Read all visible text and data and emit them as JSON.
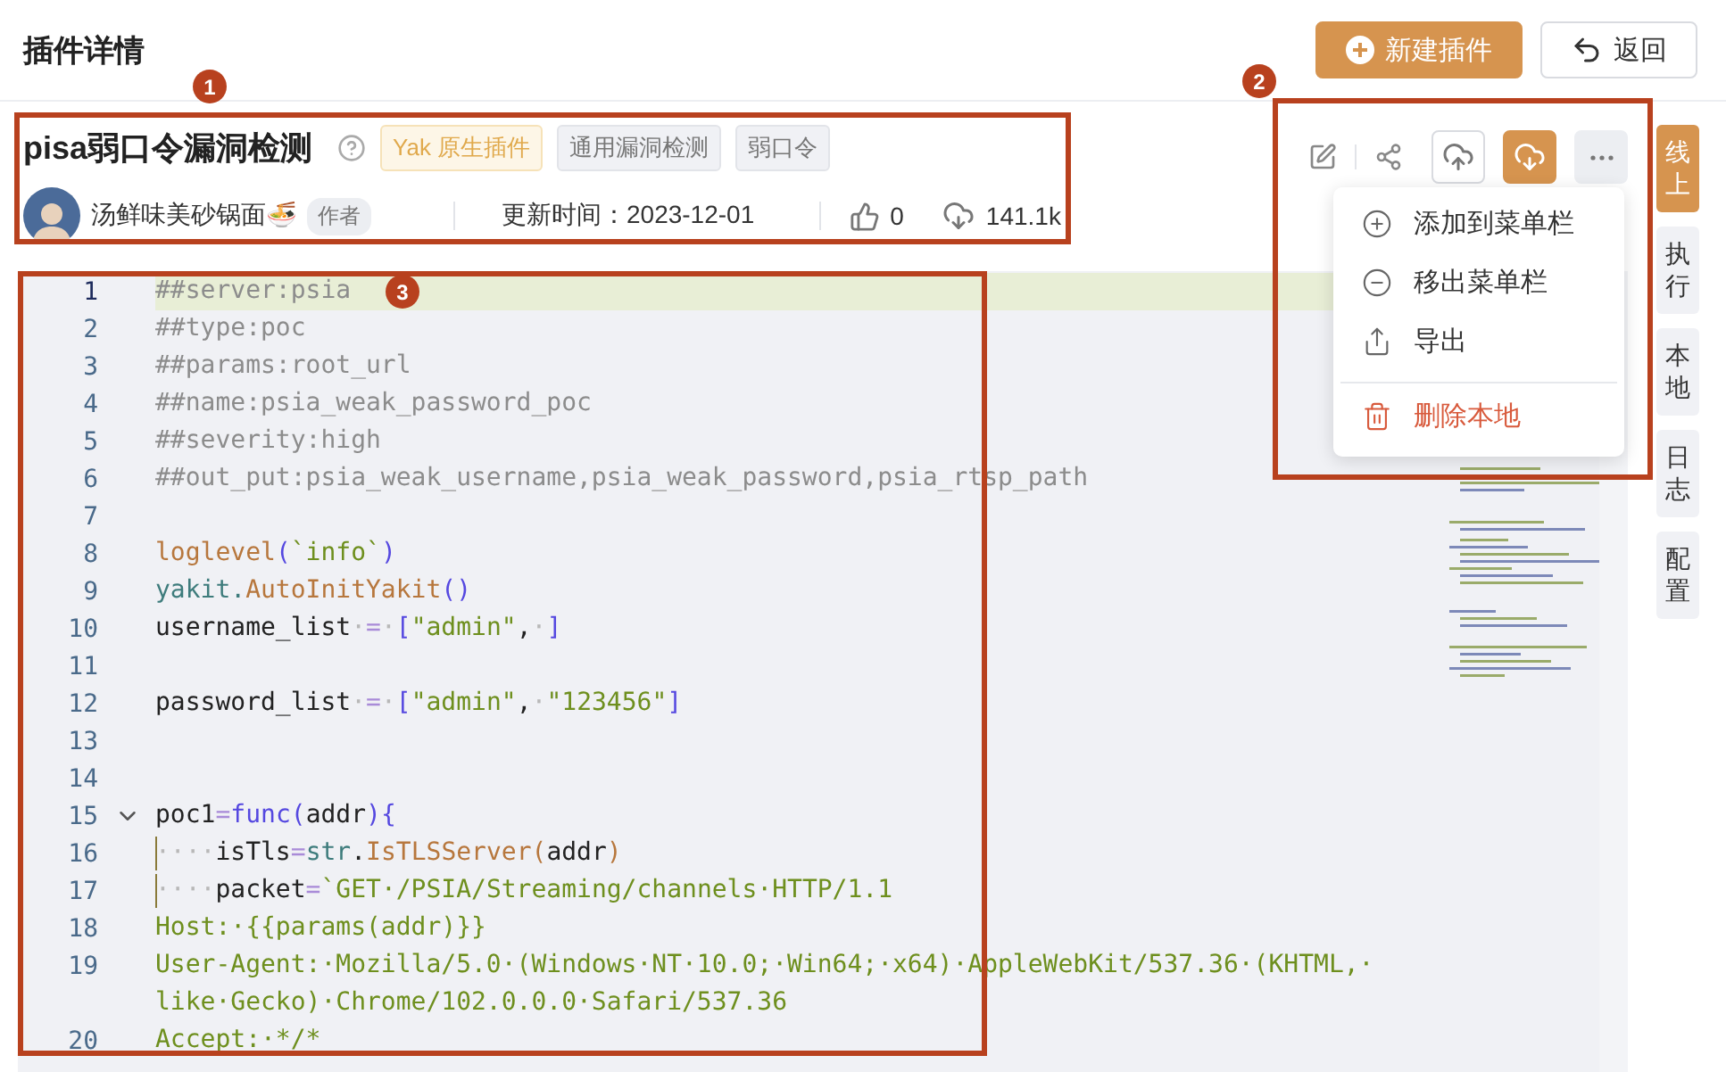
{
  "header": {
    "title": "插件详情",
    "new_button": "新建插件",
    "back_button": "返回"
  },
  "plugin": {
    "name": "pisa弱口令漏洞检测",
    "tags": [
      {
        "label": "Yak 原生插件",
        "kind": "type"
      },
      {
        "label": "通用漏洞检测",
        "kind": "tag"
      },
      {
        "label": "弱口令",
        "kind": "tag"
      }
    ],
    "author": "汤鲜味美砂锅面🍜",
    "author_badge": "作者",
    "updated": "更新时间：2023-12-01",
    "likes": "0",
    "downloads": "141.1k"
  },
  "menu": [
    {
      "label": "添加到菜单栏",
      "kind": "add",
      "danger": false
    },
    {
      "label": "移出菜单栏",
      "kind": "remove",
      "danger": false
    },
    {
      "label": "导出",
      "kind": "export",
      "danger": false
    },
    {
      "label": "删除本地",
      "kind": "delete",
      "danger": true
    }
  ],
  "tabs": [
    {
      "label": "线上",
      "selected": true
    },
    {
      "label": "执行",
      "selected": false
    },
    {
      "label": "本地",
      "selected": false
    },
    {
      "label": "日志",
      "selected": false
    },
    {
      "label": "配置",
      "selected": false
    }
  ],
  "code": {
    "lines": [
      {
        "number": "1",
        "current": true,
        "segments": [
          {
            "kind": "comment",
            "text": "##server:psia"
          }
        ]
      },
      {
        "number": "2",
        "segments": [
          {
            "kind": "comment",
            "text": "##type:poc"
          }
        ]
      },
      {
        "number": "3",
        "segments": [
          {
            "kind": "comment",
            "text": "##params:root_url"
          }
        ]
      },
      {
        "number": "4",
        "segments": [
          {
            "kind": "comment",
            "text": "##name:psia_weak_password_poc"
          }
        ]
      },
      {
        "number": "5",
        "segments": [
          {
            "kind": "comment",
            "text": "##severity:high"
          }
        ]
      },
      {
        "number": "6",
        "segments": [
          {
            "kind": "comment",
            "text": "##out_put:psia_weak_username,psia_weak_password,psia_rtsp_path"
          }
        ]
      },
      {
        "number": "7"
      },
      {
        "number": "8",
        "segments": [
          {
            "kind": "func",
            "text": "loglevel"
          },
          {
            "kind": "keyword",
            "text": "("
          },
          {
            "kind": "string",
            "text": "`info`"
          },
          {
            "kind": "keyword",
            "text": ")"
          }
        ]
      },
      {
        "number": "9",
        "segments": [
          {
            "kind": "object",
            "text": "yakit."
          },
          {
            "kind": "func",
            "text": "AutoInitYakit"
          },
          {
            "kind": "keyword",
            "text": "()"
          }
        ]
      },
      {
        "number": "10",
        "segments": [
          {
            "kind": "plain",
            "text": "username_list"
          },
          {
            "kind": "ws",
            "text": "·"
          },
          {
            "kind": "op",
            "text": "="
          },
          {
            "kind": "ws",
            "text": "·"
          },
          {
            "kind": "keyword",
            "text": "["
          },
          {
            "kind": "string",
            "text": "\"admin\""
          },
          {
            "kind": "plain",
            "text": ","
          },
          {
            "kind": "ws",
            "text": "·"
          },
          {
            "kind": "keyword",
            "text": "]"
          }
        ]
      },
      {
        "number": "11"
      },
      {
        "number": "12",
        "segments": [
          {
            "kind": "plain",
            "text": "password_list"
          },
          {
            "kind": "ws",
            "text": "·"
          },
          {
            "kind": "op",
            "text": "="
          },
          {
            "kind": "ws",
            "text": "·"
          },
          {
            "kind": "keyword",
            "text": "["
          },
          {
            "kind": "string",
            "text": "\"admin\""
          },
          {
            "kind": "plain",
            "text": ","
          },
          {
            "kind": "ws",
            "text": "·"
          },
          {
            "kind": "string",
            "text": "\"123456\""
          },
          {
            "kind": "keyword",
            "text": "]"
          }
        ]
      },
      {
        "number": "13"
      },
      {
        "number": "14"
      },
      {
        "number": "15",
        "foldable": true,
        "segments": [
          {
            "kind": "plain",
            "text": "poc1"
          },
          {
            "kind": "op",
            "text": "="
          },
          {
            "kind": "keyword",
            "text": "func"
          },
          {
            "kind": "keyword",
            "text": "("
          },
          {
            "kind": "plain",
            "text": "addr"
          },
          {
            "kind": "keyword",
            "text": "){"
          }
        ]
      },
      {
        "number": "16",
        "segments": [
          {
            "kind": "ws",
            "text": "····"
          },
          {
            "kind": "plain",
            "text": "isTls"
          },
          {
            "kind": "op",
            "text": "="
          },
          {
            "kind": "object",
            "text": "str"
          },
          {
            "kind": "plain",
            "text": "."
          },
          {
            "kind": "func",
            "text": "IsTLSServer"
          },
          {
            "kind": "func",
            "text": "("
          },
          {
            "kind": "plain",
            "text": "addr"
          },
          {
            "kind": "func",
            "text": ")"
          }
        ]
      },
      {
        "number": "17",
        "segments": [
          {
            "kind": "ws",
            "text": "····"
          },
          {
            "kind": "plain",
            "text": "packet"
          },
          {
            "kind": "op",
            "text": "="
          },
          {
            "kind": "string",
            "text": "`GET·/PSIA/Streaming/channels·HTTP/1.1"
          }
        ]
      },
      {
        "number": "18",
        "segments": [
          {
            "kind": "string",
            "text": "Host:·{{params(addr)}}"
          }
        ]
      },
      {
        "number": "19",
        "segments": [
          {
            "kind": "string",
            "text": "User-Agent:·Mozilla/5.0·(Windows·NT·10.0;·Win64;·x64)·AppleWebKit/537.36·(KHTML,·"
          }
        ],
        "continuation": [
          {
            "kind": "string",
            "text": "like·Gecko)·Chrome/102.0.0.0·Safari/537.36"
          }
        ]
      },
      {
        "number": "20",
        "segments": [
          {
            "kind": "string",
            "text": "Accept:·*/*"
          }
        ]
      }
    ]
  },
  "annotations": [
    {
      "label": "1"
    },
    {
      "label": "2"
    },
    {
      "label": "3"
    }
  ]
}
